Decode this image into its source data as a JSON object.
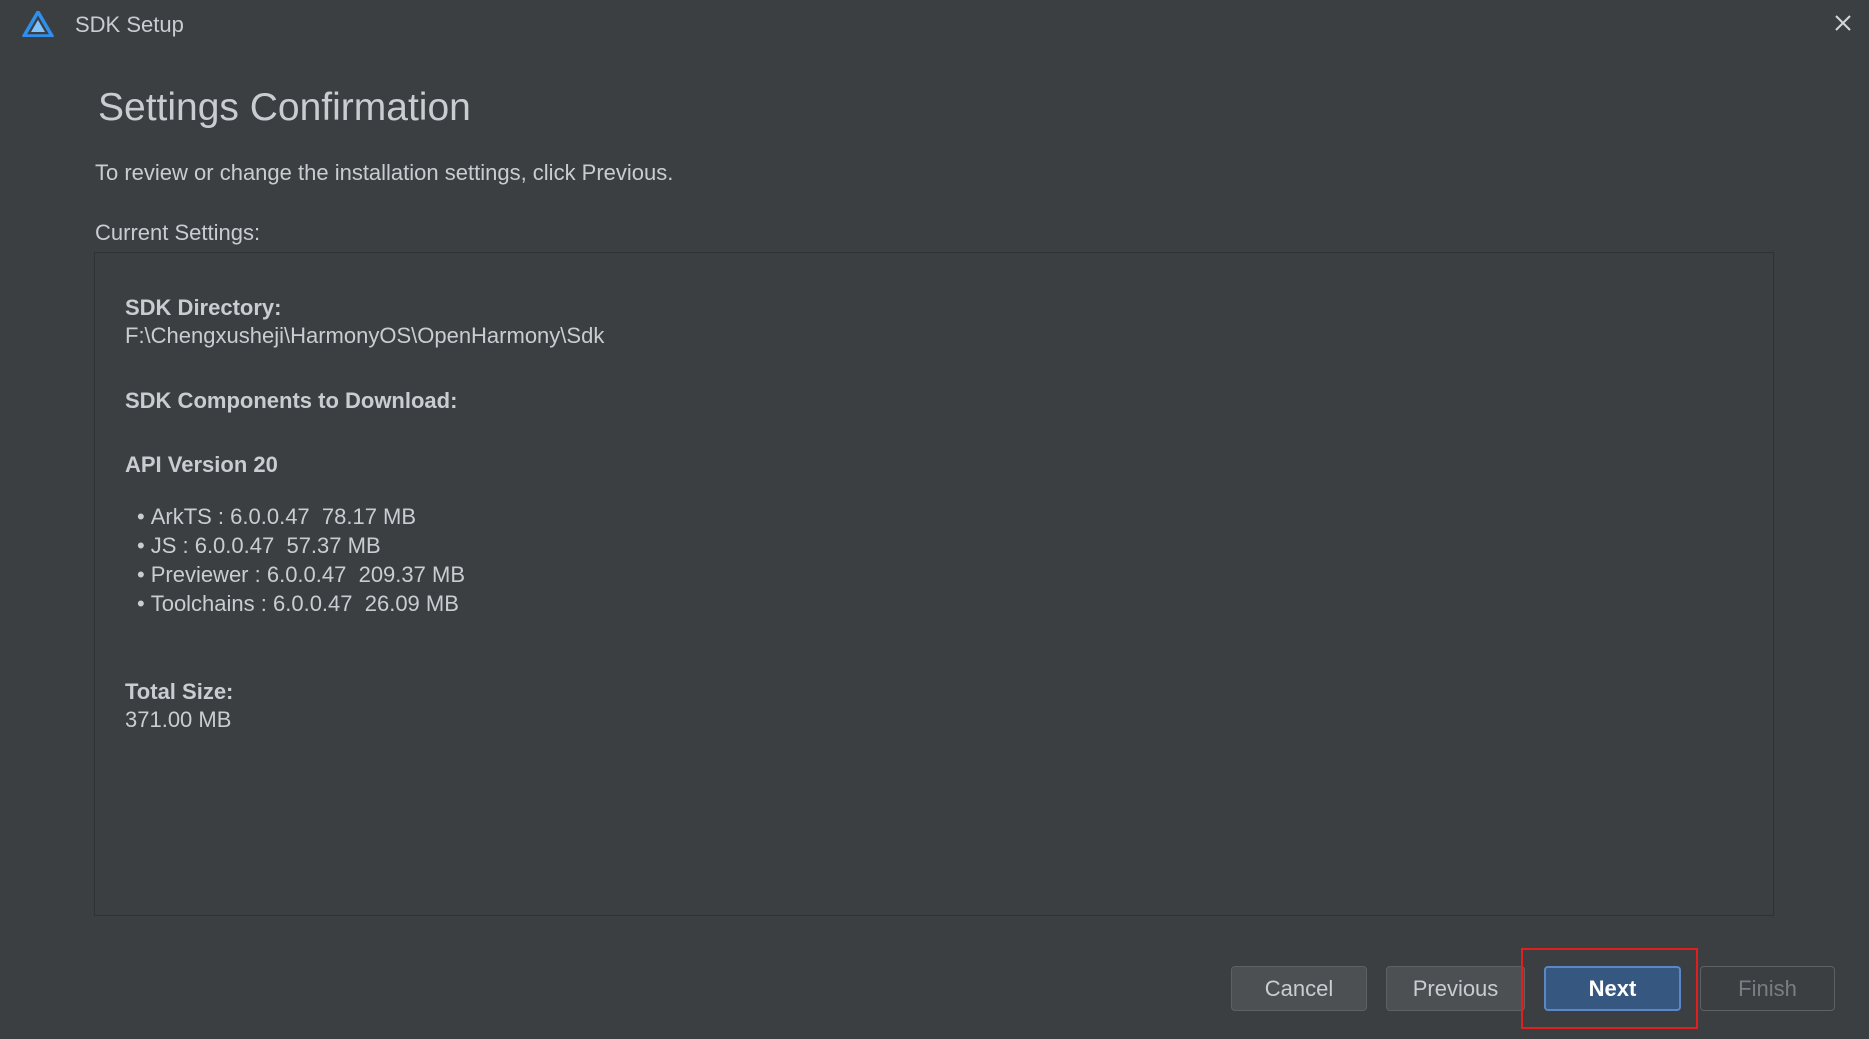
{
  "window": {
    "title": "SDK Setup"
  },
  "page": {
    "title": "Settings Confirmation",
    "intro": "To review or change the installation settings, click Previous.",
    "current_settings_label": "Current Settings:"
  },
  "settings": {
    "sdk_directory_label": "SDK Directory:",
    "sdk_directory_value": "F:\\Chengxusheji\\HarmonyOS\\OpenHarmony\\Sdk",
    "components_label": "SDK Components to Download:",
    "api_version_label": "API Version 20",
    "components": [
      {
        "text": "ArkTS : 6.0.0.47  78.17 MB"
      },
      {
        "text": "JS : 6.0.0.47  57.37 MB"
      },
      {
        "text": "Previewer : 6.0.0.47  209.37 MB"
      },
      {
        "text": "Toolchains : 6.0.0.47  26.09 MB"
      }
    ],
    "total_size_label": "Total Size:",
    "total_size_value": "371.00 MB"
  },
  "buttons": {
    "cancel": "Cancel",
    "previous": "Previous",
    "next": "Next",
    "finish": "Finish"
  },
  "icons": {
    "app_logo": "deveco-logo-icon",
    "close": "close-icon",
    "bullet": "•"
  },
  "colors": {
    "background": "#3c3f41",
    "text": "#c9cdd1",
    "primary_button": "#365880",
    "primary_border": "#5a87c5",
    "highlight": "#e0201e",
    "logo_blue": "#2f8ff0",
    "logo_light": "#7fc4ff"
  }
}
